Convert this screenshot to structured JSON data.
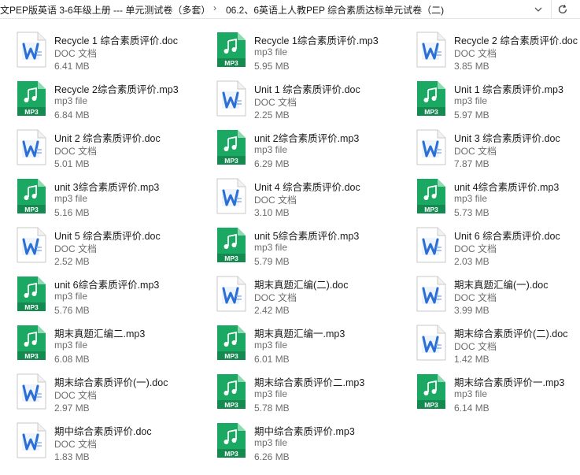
{
  "breadcrumb": {
    "part1": "文PEP版英语 3-6年级上册 --- 单元测试卷（多套）",
    "separator": "›",
    "part2": "06.2、6英语上人教PEP 综合素质达标单元试卷（二)"
  },
  "colors": {
    "doc_blue": "#2b6fd6",
    "mp3_green": "#1aa862",
    "meta_gray": "#6d6d6d"
  },
  "files": [
    {
      "name": "Recycle 1 综合素质评价.doc",
      "type": "DOC 文档",
      "size": "6.41 MB",
      "kind": "doc"
    },
    {
      "name": "Recycle 1综合素质评价.mp3",
      "type": "mp3 file",
      "size": "5.95 MB",
      "kind": "mp3"
    },
    {
      "name": "Recycle 2 综合素质评价.doc",
      "type": "DOC 文档",
      "size": "3.85 MB",
      "kind": "doc"
    },
    {
      "name": "Recycle 2综合素质评价.mp3",
      "type": "mp3 file",
      "size": "6.84 MB",
      "kind": "mp3"
    },
    {
      "name": "Unit 1 综合素质评价.doc",
      "type": "DOC 文档",
      "size": "2.25 MB",
      "kind": "doc"
    },
    {
      "name": "Unit 1 综合素质评价.mp3",
      "type": "mp3 file",
      "size": "5.97 MB",
      "kind": "mp3"
    },
    {
      "name": "Unit 2 综合素质评价.doc",
      "type": "DOC 文档",
      "size": "5.01 MB",
      "kind": "doc"
    },
    {
      "name": "unit 2综合素质评价.mp3",
      "type": "mp3 file",
      "size": "6.29 MB",
      "kind": "mp3"
    },
    {
      "name": "Unit 3 综合素质评价.doc",
      "type": "DOC 文档",
      "size": "7.87 MB",
      "kind": "doc"
    },
    {
      "name": "unit 3综合素质评价.mp3",
      "type": "mp3 file",
      "size": "5.16 MB",
      "kind": "mp3"
    },
    {
      "name": "Unit 4 综合素质评价.doc",
      "type": "DOC 文档",
      "size": "3.10 MB",
      "kind": "doc"
    },
    {
      "name": "unit 4综合素质评价.mp3",
      "type": "mp3 file",
      "size": "5.73 MB",
      "kind": "mp3"
    },
    {
      "name": "Unit 5 综合素质评价.doc",
      "type": "DOC 文档",
      "size": "2.52 MB",
      "kind": "doc"
    },
    {
      "name": "unit 5综合素质评价.mp3",
      "type": "mp3 file",
      "size": "5.79 MB",
      "kind": "mp3"
    },
    {
      "name": "Unit 6 综合素质评价.doc",
      "type": "DOC 文档",
      "size": "2.03 MB",
      "kind": "doc"
    },
    {
      "name": "unit 6综合素质评价.mp3",
      "type": "mp3 file",
      "size": "5.76 MB",
      "kind": "mp3"
    },
    {
      "name": "期末真题汇编(二).doc",
      "type": "DOC 文档",
      "size": "2.42 MB",
      "kind": "doc"
    },
    {
      "name": "期末真题汇编(一).doc",
      "type": "DOC 文档",
      "size": "3.99 MB",
      "kind": "doc"
    },
    {
      "name": "期末真题汇编二.mp3",
      "type": "mp3 file",
      "size": "6.08 MB",
      "kind": "mp3"
    },
    {
      "name": "期末真题汇编一.mp3",
      "type": "mp3 file",
      "size": "6.01 MB",
      "kind": "mp3"
    },
    {
      "name": "期末综合素质评价(二).doc",
      "type": "DOC 文档",
      "size": "1.42 MB",
      "kind": "doc"
    },
    {
      "name": "期末综合素质评价(一).doc",
      "type": "DOC 文档",
      "size": "2.97 MB",
      "kind": "doc"
    },
    {
      "name": "期末综合素质评价二.mp3",
      "type": "mp3 file",
      "size": "5.78 MB",
      "kind": "mp3"
    },
    {
      "name": "期末综合素质评价一.mp3",
      "type": "mp3 file",
      "size": "6.14 MB",
      "kind": "mp3"
    },
    {
      "name": "期中综合素质评价.doc",
      "type": "DOC 文档",
      "size": "1.83 MB",
      "kind": "doc"
    },
    {
      "name": "期中综合素质评价.mp3",
      "type": "mp3 file",
      "size": "6.26 MB",
      "kind": "mp3"
    }
  ],
  "icons": {
    "doc": "word-document-icon",
    "mp3": "mp3-audio-icon",
    "mp3_badge": "MP3",
    "dropdown": "chevron-down-icon",
    "refresh": "refresh-icon"
  }
}
